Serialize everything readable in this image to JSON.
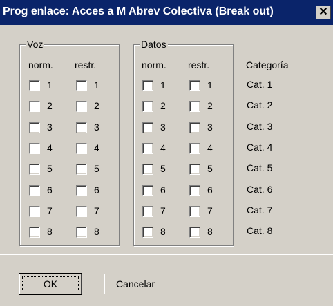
{
  "window": {
    "title": "Prog enlace: Acces a M Abrev Colectiva (Break out)",
    "close_glyph": "✕"
  },
  "groups": {
    "voz": {
      "label": "Voz",
      "col_normal": "norm.",
      "col_restr": "restr."
    },
    "datos": {
      "label": "Datos",
      "col_normal": "norm.",
      "col_restr": "restr."
    }
  },
  "rows": [
    {
      "num": "1",
      "category": "Cat. 1"
    },
    {
      "num": "2",
      "category": "Cat. 2"
    },
    {
      "num": "3",
      "category": "Cat. 3"
    },
    {
      "num": "4",
      "category": "Cat. 4"
    },
    {
      "num": "5",
      "category": "Cat. 5"
    },
    {
      "num": "6",
      "category": "Cat. 6"
    },
    {
      "num": "7",
      "category": "Cat. 7"
    },
    {
      "num": "8",
      "category": "Cat. 8"
    }
  ],
  "category_header": "Categoría",
  "buttons": {
    "ok": "OK",
    "cancel": "Cancelar"
  }
}
